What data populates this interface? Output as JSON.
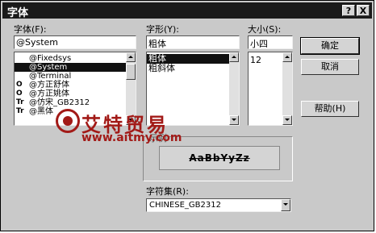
{
  "window": {
    "title": "字体",
    "help_btn": "?",
    "close_btn": "X"
  },
  "font": {
    "label": "字体(F):",
    "value": "@System",
    "items": [
      {
        "label": "@Fixedsys",
        "icon": "",
        "selected": false
      },
      {
        "label": "@System",
        "icon": "",
        "selected": true
      },
      {
        "label": "@Terminal",
        "icon": "",
        "selected": false
      },
      {
        "label": "@方正舒体",
        "icon": "O",
        "selected": false
      },
      {
        "label": "@方正姚体",
        "icon": "O",
        "selected": false
      },
      {
        "label": "@仿宋_GB2312",
        "icon": "Tr",
        "selected": false
      },
      {
        "label": "@黑体",
        "icon": "Tr",
        "selected": false
      }
    ]
  },
  "style": {
    "label": "字形(Y):",
    "value": "粗体",
    "items": [
      {
        "label": "粗体",
        "selected": true
      },
      {
        "label": "粗斜体",
        "selected": false
      }
    ]
  },
  "size": {
    "label": "大小(S):",
    "value": "小四",
    "items": [
      {
        "label": "12",
        "selected": false
      }
    ]
  },
  "buttons": {
    "ok": "确定",
    "cancel": "取消",
    "help": "帮助(H)"
  },
  "sample": {
    "label": "示例",
    "text": "AaBbYyZz"
  },
  "charset": {
    "label": "字符集(R):",
    "value": "CHINESE_GB2312"
  },
  "watermark": {
    "brand": "艾特贸易",
    "url": "www.aitmy.com"
  },
  "colors": {
    "titlebar": "#1a1a1a",
    "dialog_bg": "#c9c9c9",
    "selection": "#111111",
    "watermark": "#a21a17"
  }
}
